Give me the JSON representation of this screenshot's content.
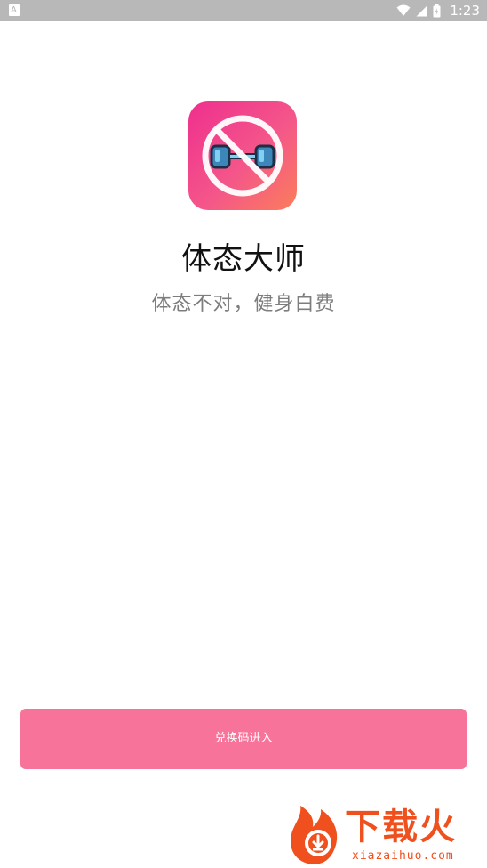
{
  "status_bar": {
    "notification_icon": "android-notification-icon",
    "wifi_icon": "wifi-icon",
    "signal_icon": "cell-signal-icon",
    "battery_icon": "battery-icon",
    "time": "1:23"
  },
  "app": {
    "icon": "dumbbell-prohibited-icon",
    "name": "体态大师",
    "slogan": "体态不对，健身白费"
  },
  "actions": {
    "redeem_label": "兑换码进入"
  },
  "watermark": {
    "title": "下载火",
    "url": "xiazaihuo.com"
  },
  "colors": {
    "button": "#f77399",
    "icon_gradient_start": "#ef2f8e",
    "icon_gradient_end": "#fb7d5a",
    "watermark": "#f0501e"
  }
}
